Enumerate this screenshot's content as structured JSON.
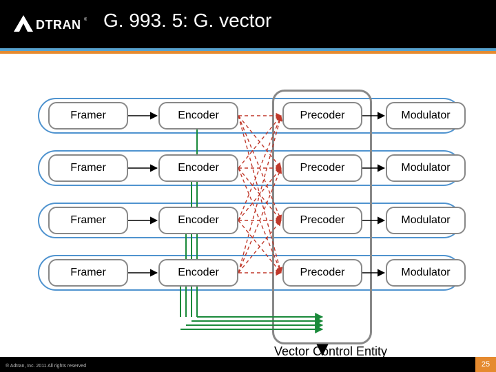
{
  "brand": {
    "name": "ADTRAN"
  },
  "title": "G. 993. 5:  G. vector",
  "stages": {
    "framer": "Framer",
    "encoder": "Encoder",
    "precoder": "Precoder",
    "modulator": "Modulator"
  },
  "rows": [
    0,
    1,
    2,
    3
  ],
  "vce_label": "Vector Control Entity",
  "footer": {
    "copyright": "® Adtran, Inc. 2011  All rights reserved",
    "page": "25"
  },
  "colors": {
    "accent_blue": "#4f93cf",
    "accent_orange": "#e58a2f"
  }
}
